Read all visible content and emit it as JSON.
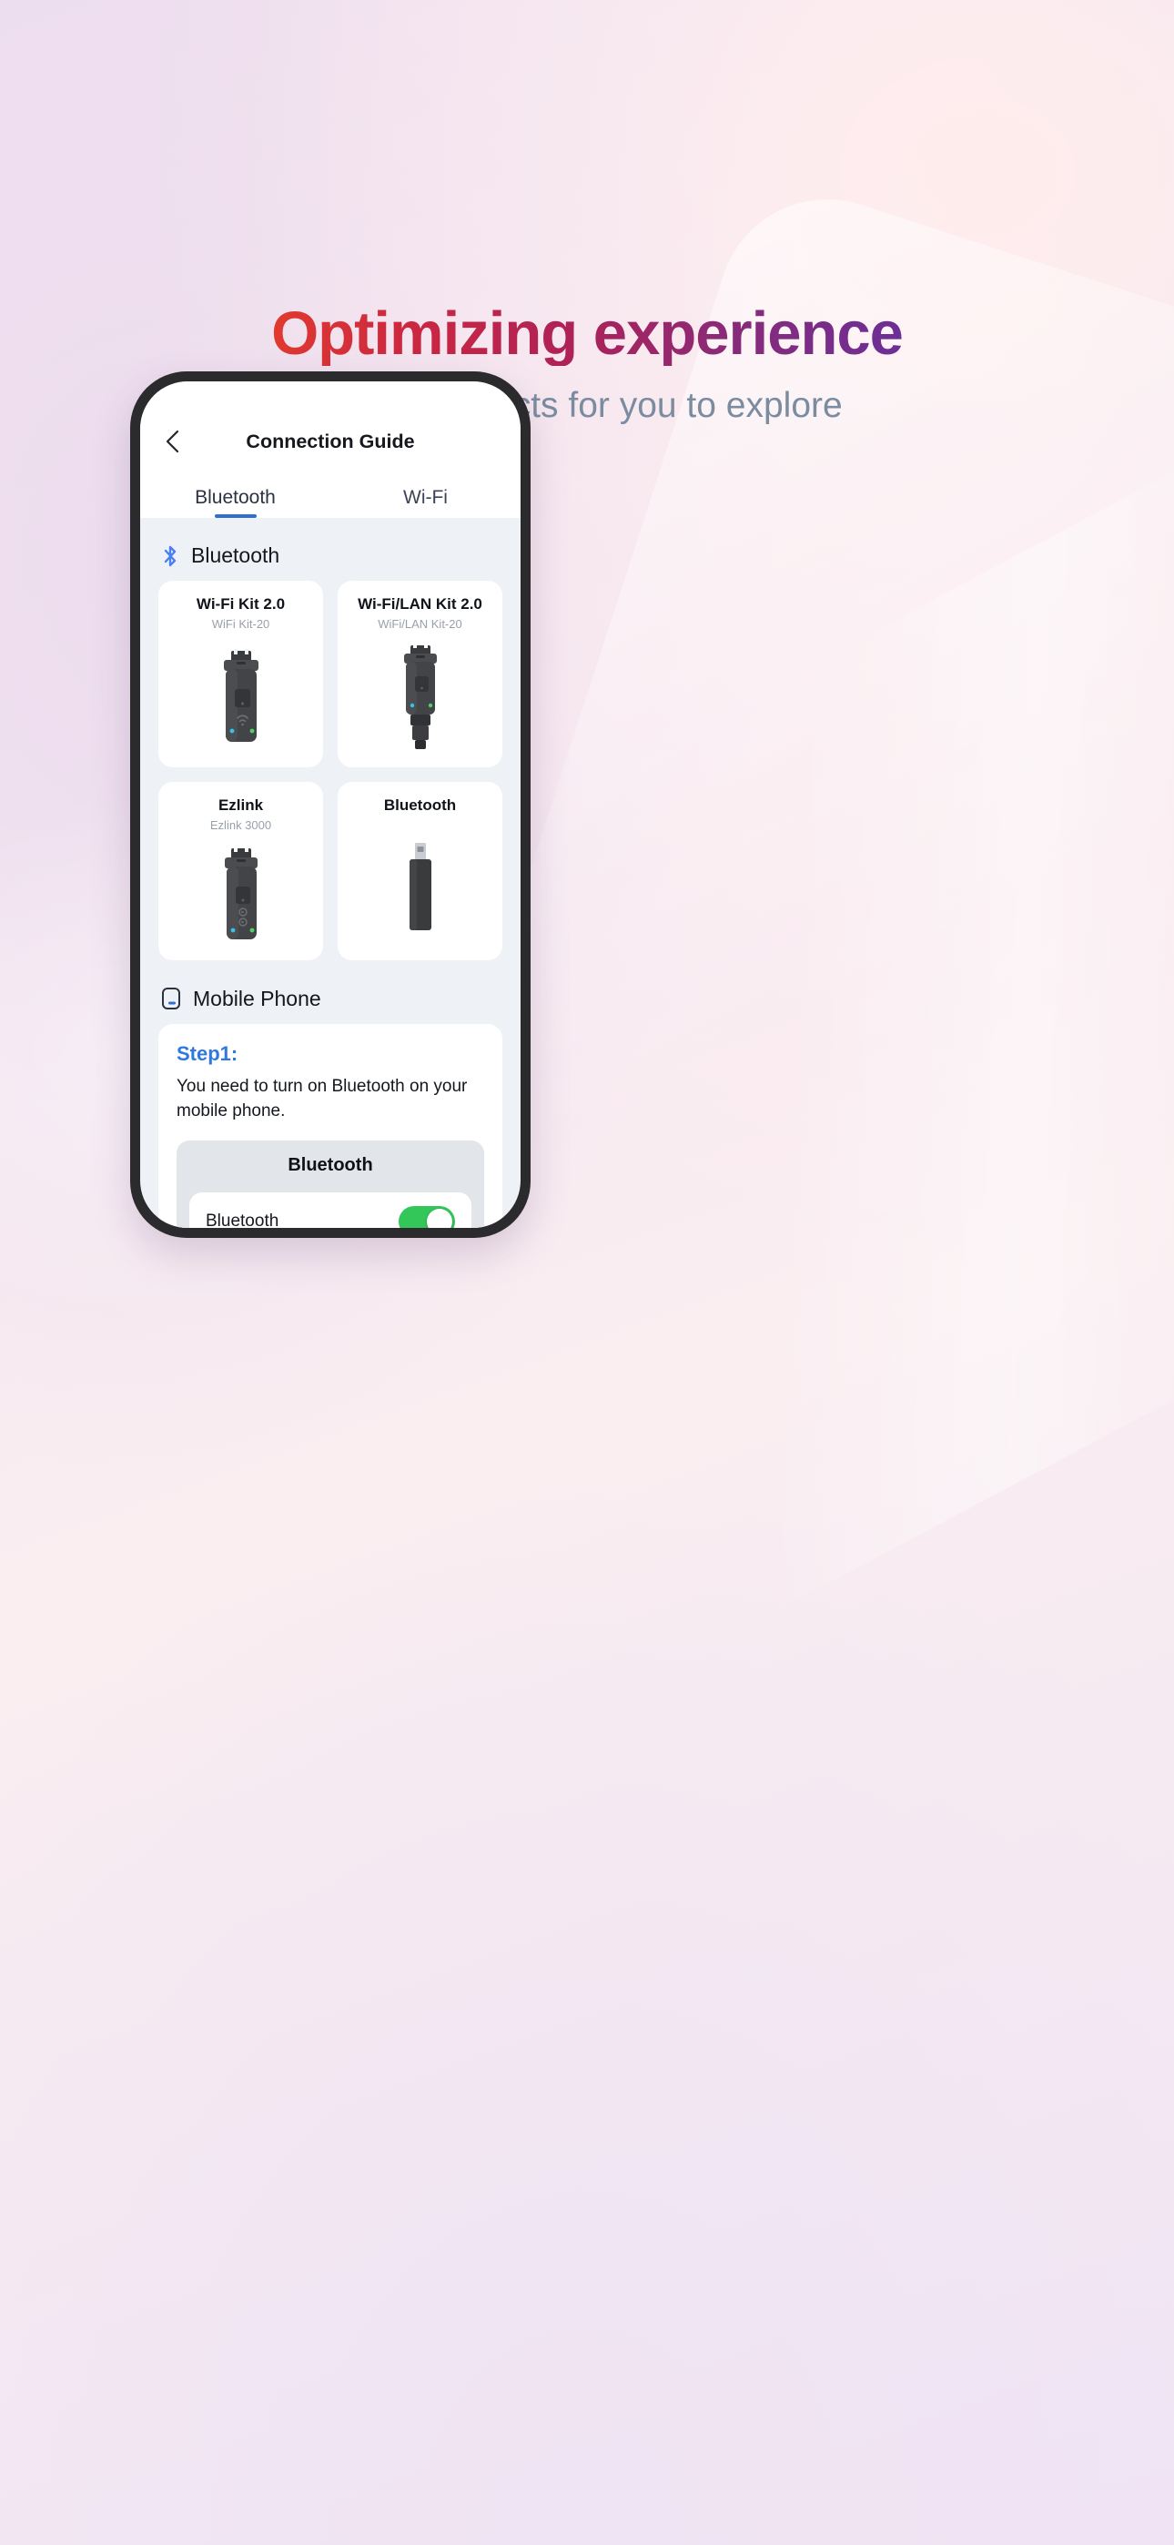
{
  "hero": {
    "title": "Optimizing experience",
    "subtitle": "More products for you to explore",
    "title_gradient_from": "#e03a2f",
    "title_gradient_to": "#6b2f96",
    "subtitle_color": "#7b8ca0"
  },
  "phone": {
    "nav": {
      "back_icon": "chevron-left-icon",
      "title": "Connection Guide"
    },
    "tabs": [
      {
        "label": "Bluetooth",
        "active": true
      },
      {
        "label": "Wi-Fi",
        "active": false
      }
    ],
    "tab_accent": "#2f6fd0",
    "sections": [
      {
        "icon": "bluetooth-icon",
        "title": "Bluetooth",
        "products": [
          {
            "name": "Wi-Fi Kit 2.0",
            "model": "WiFi Kit-20",
            "image": "wifi-kit-dongle-image"
          },
          {
            "name": "Wi-Fi/LAN Kit 2.0",
            "model": "WiFi/LAN Kit-20",
            "image": "wifi-lan-kit-dongle-image"
          },
          {
            "name": "Ezlink",
            "model": "Ezlink 3000",
            "image": "ezlink-dongle-image"
          },
          {
            "name": "Bluetooth",
            "model": "",
            "image": "usb-bluetooth-adapter-image"
          }
        ]
      },
      {
        "icon": "mobile-phone-icon",
        "title": "Mobile Phone"
      }
    ],
    "step": {
      "title": "Step1:",
      "title_color": "#2f78e0",
      "text": "You need to turn on Bluetooth on your mobile phone.",
      "panel": {
        "title": "Bluetooth",
        "row_label": "Bluetooth",
        "toggle_on": true,
        "toggle_on_color": "#33c759"
      }
    }
  }
}
